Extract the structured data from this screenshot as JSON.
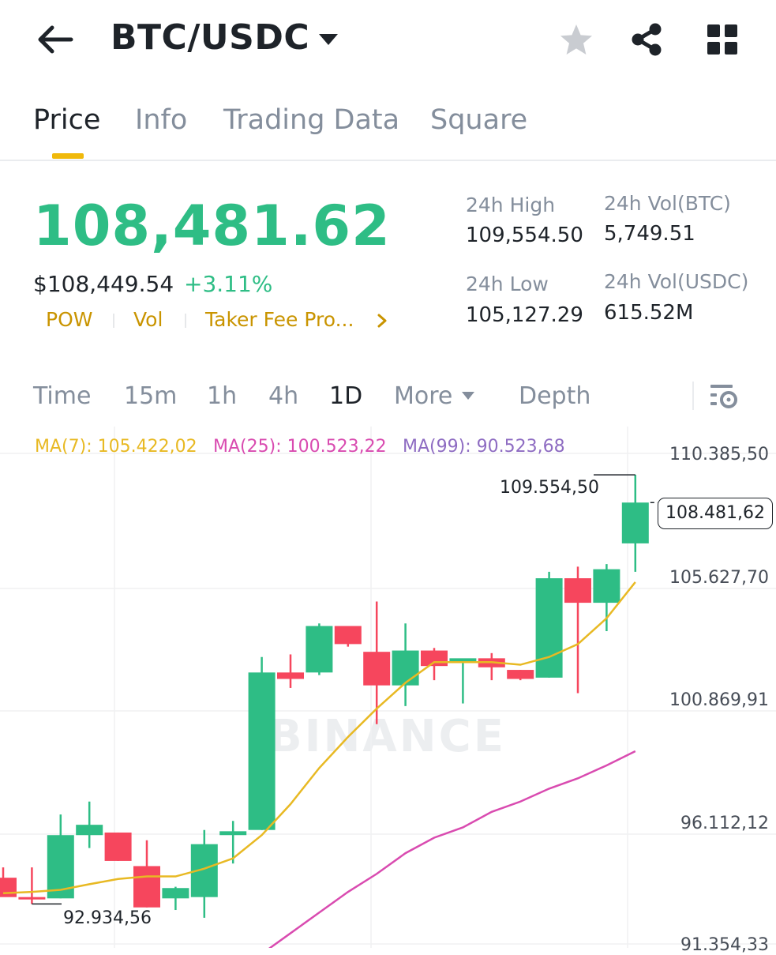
{
  "header": {
    "pair": "BTC/USDC",
    "icons": [
      "back-arrow-icon",
      "caret-down-icon",
      "star-icon",
      "share-icon",
      "grid-icon"
    ]
  },
  "tabs": [
    {
      "label": "Price",
      "active": true
    },
    {
      "label": "Info",
      "active": false
    },
    {
      "label": "Trading Data",
      "active": false
    },
    {
      "label": "Square",
      "active": false
    }
  ],
  "price": {
    "last": "108,481.62",
    "usd": "$108,449.54",
    "change": "+3.11%",
    "tags": [
      "POW",
      "Vol",
      "Taker Fee Pro..."
    ],
    "stats": {
      "high_label": "24h High",
      "high": "109,554.50",
      "low_label": "24h Low",
      "low": "105,127.29",
      "vol_btc_label": "24h Vol(BTC)",
      "vol_btc": "5,749.51",
      "vol_usdc_label": "24h Vol(USDC)",
      "vol_usdc": "615.52M"
    }
  },
  "intervals": [
    {
      "label": "Time",
      "active": false
    },
    {
      "label": "15m",
      "active": false
    },
    {
      "label": "1h",
      "active": false
    },
    {
      "label": "4h",
      "active": false
    },
    {
      "label": "1D",
      "active": true
    },
    {
      "label": "More",
      "active": false
    },
    {
      "label": "Depth",
      "active": false
    }
  ],
  "colors": {
    "up": "#2ebd85",
    "down": "#f6465d",
    "ma7": "#e8b923",
    "ma25": "#d94bb0",
    "ma99": "#8e6cc2",
    "accent": "#f0b90b"
  },
  "chart_data": {
    "type": "candlestick",
    "ma": [
      {
        "label": "MA(7): 105.422,02",
        "color": "#e8b923"
      },
      {
        "label": "MA(25): 100.523,22",
        "color": "#d94bb0"
      },
      {
        "label": "MA(99): 90.523,68",
        "color": "#8e6cc2"
      }
    ],
    "y_ticks": [
      "110.385,50",
      "105.627,70",
      "100.869,91",
      "96.112,12",
      "91.354,33"
    ],
    "ylim": [
      91354.33,
      110385.5
    ],
    "current_price_label": "108.481,62",
    "high_label": "109.554,50",
    "low_label": "92.934,56",
    "watermark": "BINANCE",
    "candles": [
      {
        "o": 93950,
        "h": 94350,
        "l": 93300,
        "c": 93200
      },
      {
        "o": 93200,
        "h": 94350,
        "l": 92934.56,
        "c": 93150
      },
      {
        "o": 93150,
        "h": 96400,
        "l": 93150,
        "c": 95600
      },
      {
        "o": 95600,
        "h": 96900,
        "l": 95100,
        "c": 96000
      },
      {
        "o": 95700,
        "h": 95700,
        "l": 94600,
        "c": 94600
      },
      {
        "o": 94400,
        "h": 95400,
        "l": 92800,
        "c": 92800
      },
      {
        "o": 93150,
        "h": 93600,
        "l": 92700,
        "c": 93550
      },
      {
        "o": 93200,
        "h": 95800,
        "l": 92400,
        "c": 95250
      },
      {
        "o": 95600,
        "h": 96150,
        "l": 94500,
        "c": 95750
      },
      {
        "o": 95800,
        "h": 102500,
        "l": 95800,
        "c": 101900
      },
      {
        "o": 101900,
        "h": 102600,
        "l": 101300,
        "c": 101650
      },
      {
        "o": 101900,
        "h": 103800,
        "l": 101800,
        "c": 103700
      },
      {
        "o": 103700,
        "h": 103700,
        "l": 102900,
        "c": 103000
      },
      {
        "o": 102700,
        "h": 104650,
        "l": 99900,
        "c": 101400
      },
      {
        "o": 101400,
        "h": 103800,
        "l": 100600,
        "c": 102750
      },
      {
        "o": 102750,
        "h": 102850,
        "l": 101600,
        "c": 102150
      },
      {
        "o": 102300,
        "h": 102400,
        "l": 100700,
        "c": 102450
      },
      {
        "o": 102450,
        "h": 102650,
        "l": 101600,
        "c": 102100
      },
      {
        "o": 102000,
        "h": 102000,
        "l": 101600,
        "c": 101650
      },
      {
        "o": 101700,
        "h": 105800,
        "l": 101700,
        "c": 105550
      },
      {
        "o": 105550,
        "h": 106000,
        "l": 101100,
        "c": 104600
      },
      {
        "o": 104600,
        "h": 106100,
        "l": 103500,
        "c": 105900
      },
      {
        "o": 106900,
        "h": 109554.5,
        "l": 105800,
        "c": 108481.62
      }
    ],
    "ma7_values": [
      93350,
      93400,
      93480,
      93700,
      93900,
      94000,
      94000,
      94300,
      94700,
      95600,
      96800,
      98200,
      99400,
      100500,
      101500,
      102300,
      102300,
      102300,
      102200,
      102500,
      103000,
      104000,
      105400
    ],
    "ma25_start_index": 8,
    "ma25_values": [
      90300,
      91000,
      91800,
      92600,
      93400,
      94100,
      94900,
      95500,
      95900,
      96500,
      96900,
      97400,
      97800,
      98300,
      98850
    ]
  }
}
